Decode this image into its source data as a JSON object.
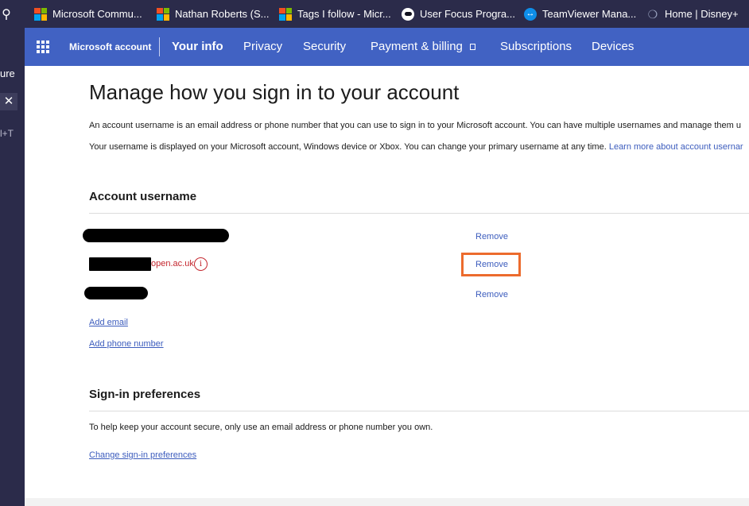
{
  "bookmarks": [
    {
      "label": "Microsoft Commu...",
      "icon": "microsoft-logo-icon"
    },
    {
      "label": "Nathan Roberts (S...",
      "icon": "microsoft-logo-icon"
    },
    {
      "label": "Tags I follow - Micr...",
      "icon": "microsoft-logo-icon"
    },
    {
      "label": "User Focus Progra...",
      "icon": "user-focus-icon"
    },
    {
      "label": "TeamViewer Mana...",
      "icon": "teamviewer-icon"
    },
    {
      "label": "Home | Disney+",
      "icon": "disney-plus-icon"
    }
  ],
  "side_panel": {
    "text": "ure",
    "close_glyph": "✕",
    "shortcut": "l+T",
    "pin_glyph": "⚲"
  },
  "nav": {
    "brand": "Microsoft account",
    "links": [
      "Your info",
      "Privacy",
      "Security",
      "Payment & billing",
      "Subscriptions",
      "Devices"
    ],
    "active": "Your info",
    "background": "#4162c3"
  },
  "main": {
    "title": "Manage how you sign in to your account",
    "intro1": "An account username is an email address or phone number that you can use to sign in to your Microsoft account. You can have multiple usernames and manage them u",
    "intro2_text": "Your username is displayed on your Microsoft account, Windows device or Xbox. You can change your primary username at any time. ",
    "intro2_link": "Learn more about account usernar"
  },
  "account_username": {
    "heading": "Account username",
    "aliases": [
      {
        "visible_text": "",
        "action": "Remove"
      },
      {
        "visible_text": "open.ac.uk",
        "action": "Remove",
        "highlighted": true
      },
      {
        "visible_text": "",
        "action": "Remove"
      }
    ],
    "info_glyph": "i",
    "add_email": "Add email",
    "add_phone": "Add phone number"
  },
  "signin_preferences": {
    "heading": "Sign-in preferences",
    "help": "To help keep your account secure, only use an email address or phone number you own.",
    "change_link": "Change sign-in preferences"
  },
  "colors": {
    "link": "#3c5cbd",
    "warning": "#c4262e",
    "highlight": "#ec6b2d",
    "chrome": "#2b2b4a"
  }
}
